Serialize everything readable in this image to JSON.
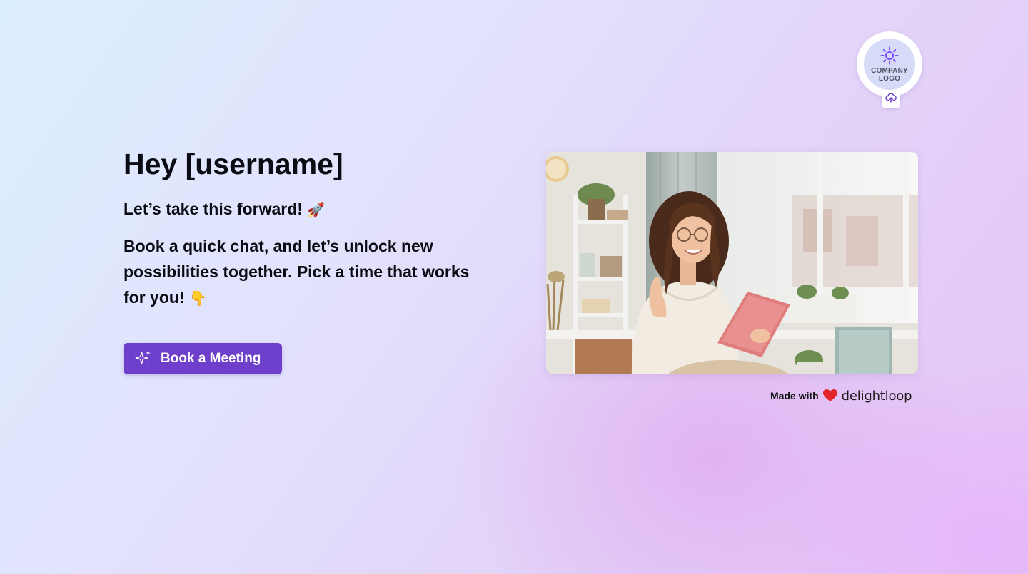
{
  "logo": {
    "line1": "COMPANY",
    "line2": "LOGO",
    "icon": "sun-icon",
    "upload_icon": "cloud-upload-icon"
  },
  "hero": {
    "headline": "Hey [username]",
    "subhead": "Let’s take this forward!",
    "subhead_emoji": "🚀",
    "body": "Book a quick chat, and let’s unlock new possibilities together. Pick a time that works for you!",
    "body_emoji": "👇"
  },
  "cta": {
    "label": "Book a Meeting",
    "icon": "sparkles-icon",
    "color": "#6e3fcb"
  },
  "photo": {
    "subject": "woman-waving-video-call-illustration"
  },
  "footer": {
    "made_with": "Made with",
    "heart_icon": "heart-icon",
    "heart_color": "#e3262b",
    "brand": "delightloop",
    "brand_accent": "#8b6cf0"
  }
}
